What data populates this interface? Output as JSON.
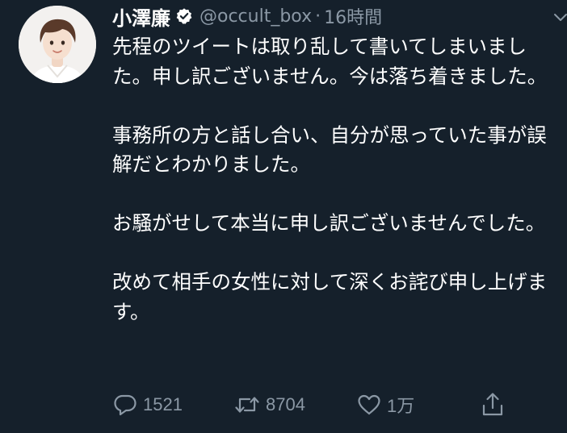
{
  "user": {
    "display_name": "小澤廉",
    "handle": "@occult_box",
    "separator": "·",
    "time": "16時間",
    "verified": true
  },
  "tweet": {
    "paragraphs": [
      "先程のツイートは取り乱して書いてしまいました。申し訳ございません。今は落ち着きました。",
      "事務所の方と話し合い、自分が思っていた事が誤解だとわかりました。",
      "お騒がせして本当に申し訳ございませんでした。",
      "改めて相手の女性に対して深くお詫び申し上げます。"
    ]
  },
  "actions": {
    "reply_count": "1521",
    "retweet_count": "8704",
    "like_count": "1万"
  },
  "icons": {
    "verified": "verified-badge-icon",
    "menu": "chevron-down-icon",
    "reply": "reply-icon",
    "retweet": "retweet-icon",
    "like": "heart-icon",
    "share": "share-icon"
  },
  "colors": {
    "background": "#15202b",
    "text": "#ffffff",
    "secondary": "#8b98a5"
  }
}
